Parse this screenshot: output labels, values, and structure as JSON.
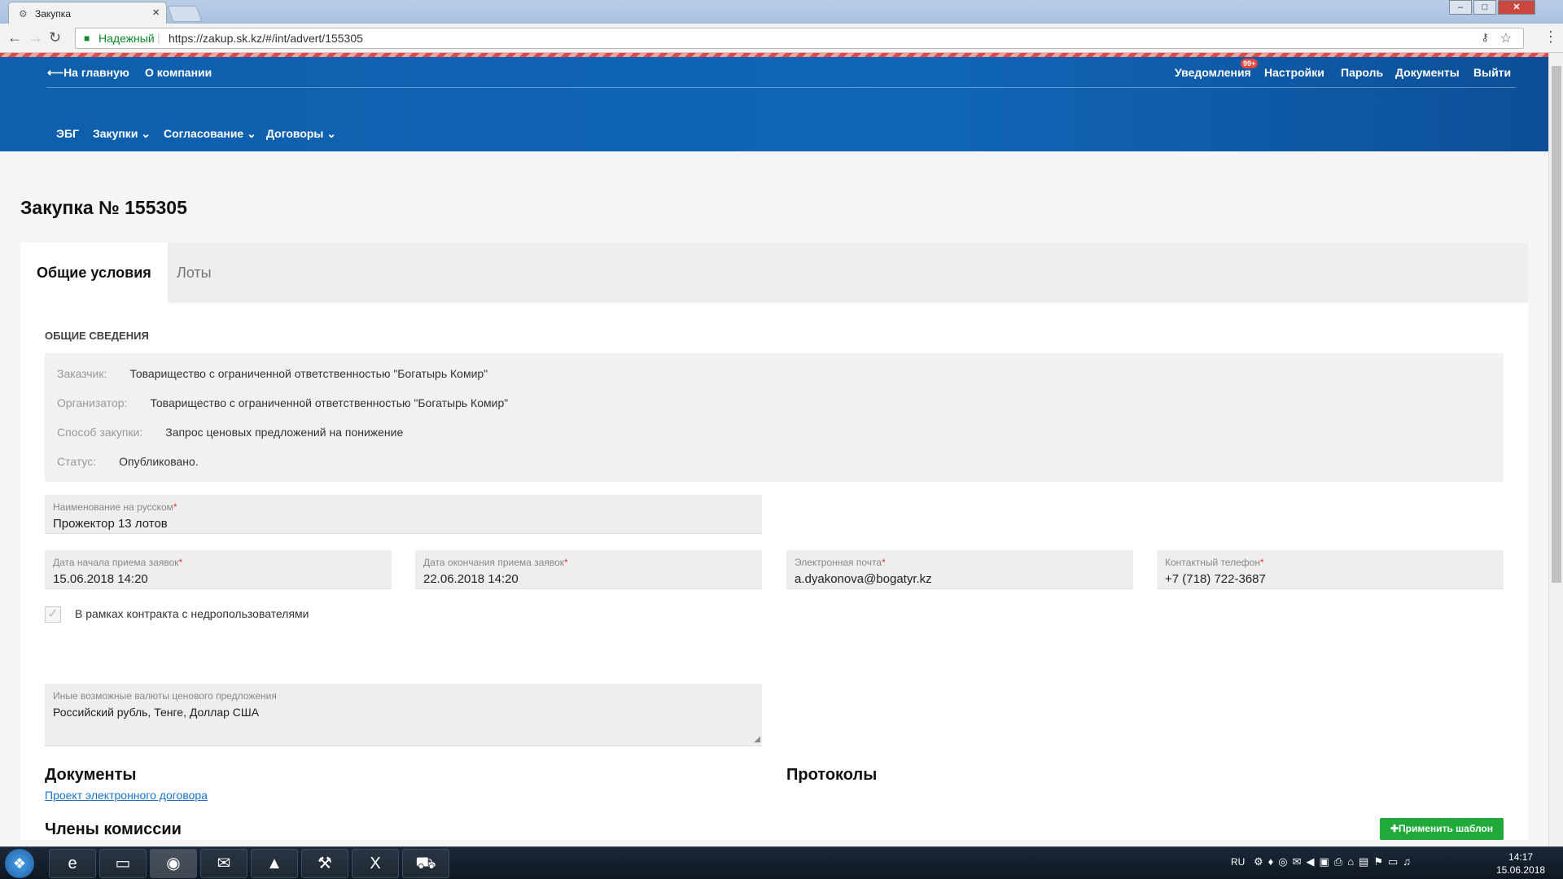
{
  "browser": {
    "tab_title": "Закупка",
    "tab_close": "×",
    "secure_label": "Надежный",
    "url": "https://zakup.sk.kz/#/int/advert/155305"
  },
  "header": {
    "back_link": "⟵На главную",
    "about": "О компании",
    "notifications": "Уведомления",
    "notifications_badge": "99+",
    "settings": "Настройки",
    "password": "Пароль",
    "documents": "Документы",
    "logout": "Выйти",
    "menu": [
      "ЭБГ",
      "Закупки ⌄",
      "Согласование ⌄",
      "Договоры ⌄"
    ]
  },
  "page": {
    "title": "Закупка № 155305",
    "tabs": [
      "Общие условия",
      "Лоты"
    ],
    "section_title": "ОБЩИЕ СВЕДЕНИЯ",
    "info": [
      {
        "label": "Заказчик:",
        "value": "Товарищество с ограниченной ответственностью \"Богатырь Комир\""
      },
      {
        "label": "Организатор:",
        "value": "Товарищество с ограниченной ответственностью \"Богатырь Комир\""
      },
      {
        "label": "Способ закупки:",
        "value": "Запрос ценовых предложений на понижение"
      },
      {
        "label": "Статус:",
        "value": "Опубликовано."
      }
    ],
    "fields": {
      "name_ru": {
        "label": "Наименование на русском",
        "value": "Прожектор 13 лотов"
      },
      "start_date": {
        "label": "Дата начала приема заявок",
        "value": "15.06.2018 14:20"
      },
      "end_date": {
        "label": "Дата окончания приема заявок",
        "value": "22.06.2018 14:20"
      },
      "email": {
        "label": "Электронная почта",
        "value": "a.dyakonova@bogatyr.kz"
      },
      "phone": {
        "label": "Контактный телефон",
        "value": "+7 (718) 722-3687"
      },
      "currencies": {
        "label": "Иные возможные валюты ценового предложения",
        "value": "Российский  рубль, Тенге, Доллар США"
      }
    },
    "required_mark": "*",
    "checkbox_label": "В рамках контракта с недропользователями",
    "documents_title": "Документы",
    "documents_link": "Проект электронного договора",
    "protocols_title": "Протоколы",
    "commission_title": "Члены комиссии",
    "apply_template_button": "✚Применить шаблон"
  },
  "taskbar": {
    "language": "RU",
    "time": "14:17",
    "date": "15.06.2018"
  }
}
